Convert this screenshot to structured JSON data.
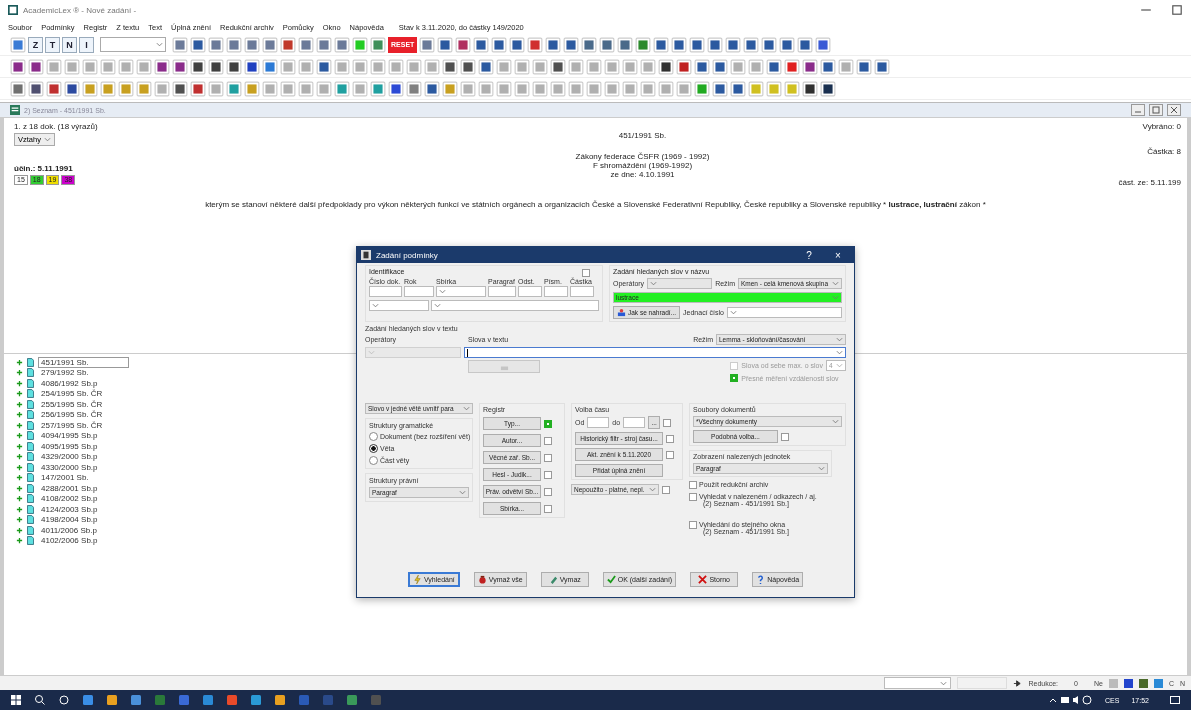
{
  "window": {
    "title": "AcademicLex ® - Nové zadání -"
  },
  "menu": [
    {
      "label": "Soubor"
    },
    {
      "label": "Podmínky"
    },
    {
      "label": "Registr"
    },
    {
      "label": "Z textu"
    },
    {
      "label": "Text"
    },
    {
      "label": "Úplná znění"
    },
    {
      "label": "Redukční archiv"
    },
    {
      "label": "Pomůcky"
    },
    {
      "label": "Okno"
    },
    {
      "label": "Nápověda"
    }
  ],
  "status_info": "Stav k 3.11.2020, do částky 149/2020",
  "toolbars": [
    {
      "items": [
        {
          "kind": "icon",
          "color": "#3a7bd5"
        },
        {
          "kind": "text",
          "label": "Z"
        },
        {
          "kind": "text",
          "label": "T"
        },
        {
          "kind": "text",
          "label": "N"
        },
        {
          "kind": "text",
          "label": "I"
        },
        {
          "kind": "combo"
        },
        {
          "kind": "icon",
          "color": "#6b7a99"
        },
        {
          "kind": "icon",
          "color": "#2c5aa0"
        },
        {
          "kind": "icon",
          "color": "#6b7a99"
        },
        {
          "kind": "icon",
          "color": "#6b7a99"
        },
        {
          "kind": "icon",
          "color": "#6b7a99"
        },
        {
          "kind": "icon",
          "color": "#6b7a99"
        },
        {
          "kind": "icon",
          "color": "#c0392b"
        },
        {
          "kind": "icon",
          "color": "#6b7a99"
        },
        {
          "kind": "icon",
          "color": "#6b7a99"
        },
        {
          "kind": "icon",
          "color": "#6b7a99"
        },
        {
          "kind": "icon",
          "color": "#22cc22"
        },
        {
          "kind": "icon",
          "color": "#3f8f5a"
        },
        {
          "kind": "badge",
          "label": "RESET",
          "color": "#e8202a"
        },
        {
          "kind": "icon",
          "color": "#6b7a99"
        },
        {
          "kind": "icon",
          "color": "#2c5aa0"
        },
        {
          "kind": "icon",
          "color": "#b03060"
        },
        {
          "kind": "icon",
          "color": "#2c5aa0"
        },
        {
          "kind": "icon",
          "color": "#2c5aa0"
        },
        {
          "kind": "icon",
          "color": "#2c5aa0"
        },
        {
          "kind": "icon",
          "color": "#d03030"
        },
        {
          "kind": "icon",
          "color": "#2c5aa0"
        },
        {
          "kind": "icon",
          "color": "#2c5aa0"
        },
        {
          "kind": "icon",
          "color": "#4a6a8a"
        },
        {
          "kind": "icon",
          "color": "#4a6a8a"
        },
        {
          "kind": "icon",
          "color": "#4a6a8a"
        },
        {
          "kind": "icon",
          "color": "#2c8a2c"
        },
        {
          "kind": "icon",
          "color": "#2c5aa0"
        },
        {
          "kind": "icon",
          "color": "#2c5aa0"
        },
        {
          "kind": "icon",
          "color": "#2c5aa0"
        },
        {
          "kind": "icon",
          "color": "#2c5aa0"
        },
        {
          "kind": "icon",
          "color": "#2c5aa0"
        },
        {
          "kind": "icon",
          "color": "#2c5aa0"
        },
        {
          "kind": "icon",
          "color": "#2c5aa0"
        },
        {
          "kind": "icon",
          "color": "#2c5aa0"
        },
        {
          "kind": "icon",
          "color": "#2c5aa0"
        },
        {
          "kind": "icon",
          "color": "#3a5ad5"
        }
      ]
    },
    {
      "items": [
        {
          "kind": "icon",
          "color": "#8a2c8a"
        },
        {
          "kind": "icon",
          "color": "#8a2c8a"
        },
        {
          "kind": "icon",
          "color": "#b0b0b0"
        },
        {
          "kind": "icon",
          "color": "#b0b0b0"
        },
        {
          "kind": "icon",
          "color": "#b0b0b0"
        },
        {
          "kind": "icon",
          "color": "#b0b0b0"
        },
        {
          "kind": "icon",
          "color": "#b0b0b0"
        },
        {
          "kind": "icon",
          "color": "#b0b0b0"
        },
        {
          "kind": "icon",
          "color": "#8a2c8a"
        },
        {
          "kind": "icon",
          "color": "#8a2c8a"
        },
        {
          "kind": "icon",
          "color": "#404040"
        },
        {
          "kind": "icon",
          "color": "#404040"
        },
        {
          "kind": "icon",
          "color": "#404040"
        },
        {
          "kind": "icon",
          "color": "#2040c0"
        },
        {
          "kind": "icon",
          "color": "#2c7ad5"
        },
        {
          "kind": "icon",
          "color": "#b0b0b0"
        },
        {
          "kind": "icon",
          "color": "#b0b0b0"
        },
        {
          "kind": "icon",
          "color": "#2c5aa0"
        },
        {
          "kind": "icon",
          "color": "#b0b0b0"
        },
        {
          "kind": "icon",
          "color": "#b0b0b0"
        },
        {
          "kind": "icon",
          "color": "#b0b0b0"
        },
        {
          "kind": "icon",
          "color": "#b0b0b0"
        },
        {
          "kind": "icon",
          "color": "#b0b0b0"
        },
        {
          "kind": "icon",
          "color": "#b0b0b0"
        },
        {
          "kind": "icon",
          "color": "#505050"
        },
        {
          "kind": "icon",
          "color": "#505050"
        },
        {
          "kind": "icon",
          "color": "#2c5aa0"
        },
        {
          "kind": "icon",
          "color": "#b0b0b0"
        },
        {
          "kind": "icon",
          "color": "#b0b0b0"
        },
        {
          "kind": "icon",
          "color": "#b0b0b0"
        },
        {
          "kind": "icon",
          "color": "#505050"
        },
        {
          "kind": "icon",
          "color": "#b0b0b0"
        },
        {
          "kind": "icon",
          "color": "#b0b0b0"
        },
        {
          "kind": "icon",
          "color": "#b0b0b0"
        },
        {
          "kind": "icon",
          "color": "#b0b0b0"
        },
        {
          "kind": "icon",
          "color": "#b0b0b0"
        },
        {
          "kind": "icon",
          "color": "#303030"
        },
        {
          "kind": "icon",
          "color": "#c02020"
        },
        {
          "kind": "icon",
          "color": "#2c5aa0"
        },
        {
          "kind": "icon",
          "color": "#2c5aa0"
        },
        {
          "kind": "icon",
          "color": "#b0b0b0"
        },
        {
          "kind": "icon",
          "color": "#b0b0b0"
        },
        {
          "kind": "icon",
          "color": "#2c5aa0"
        },
        {
          "kind": "icon",
          "color": "#e02020"
        },
        {
          "kind": "icon",
          "color": "#8a2c8a"
        },
        {
          "kind": "icon",
          "color": "#2c5aa0"
        },
        {
          "kind": "icon",
          "color": "#b0b0b0"
        },
        {
          "kind": "icon",
          "color": "#2c5aa0"
        },
        {
          "kind": "icon",
          "color": "#2c5aa0"
        }
      ]
    },
    {
      "items": [
        {
          "kind": "icon",
          "color": "#707070"
        },
        {
          "kind": "icon",
          "color": "#505070"
        },
        {
          "kind": "icon",
          "color": "#c03030"
        },
        {
          "kind": "icon",
          "color": "#2c4aa0"
        },
        {
          "kind": "icon",
          "color": "#c8a020"
        },
        {
          "kind": "icon",
          "color": "#c8a020"
        },
        {
          "kind": "icon",
          "color": "#c8a020"
        },
        {
          "kind": "icon",
          "color": "#c8a020"
        },
        {
          "kind": "icon",
          "color": "#b0b0b0"
        },
        {
          "kind": "icon",
          "color": "#505050"
        },
        {
          "kind": "icon",
          "color": "#c03030"
        },
        {
          "kind": "icon",
          "color": "#b0b0b0"
        },
        {
          "kind": "icon",
          "color": "#20a0a0"
        },
        {
          "kind": "icon",
          "color": "#c8a020"
        },
        {
          "kind": "icon",
          "color": "#b0b0b0"
        },
        {
          "kind": "icon",
          "color": "#b0b0b0"
        },
        {
          "kind": "icon",
          "color": "#b0b0b0"
        },
        {
          "kind": "icon",
          "color": "#b0b0b0"
        },
        {
          "kind": "icon",
          "color": "#20a0a0"
        },
        {
          "kind": "icon",
          "color": "#b0b0b0"
        },
        {
          "kind": "icon",
          "color": "#20a0a0"
        },
        {
          "kind": "icon",
          "color": "#2c4ad5"
        },
        {
          "kind": "icon",
          "color": "#808080"
        },
        {
          "kind": "icon",
          "color": "#2c5aa0"
        },
        {
          "kind": "icon",
          "color": "#c8a020"
        },
        {
          "kind": "icon",
          "color": "#b0b0b0"
        },
        {
          "kind": "icon",
          "color": "#b0b0b0"
        },
        {
          "kind": "icon",
          "color": "#b0b0b0"
        },
        {
          "kind": "icon",
          "color": "#b0b0b0"
        },
        {
          "kind": "icon",
          "color": "#b0b0b0"
        },
        {
          "kind": "icon",
          "color": "#b0b0b0"
        },
        {
          "kind": "icon",
          "color": "#b0b0b0"
        },
        {
          "kind": "icon",
          "color": "#b0b0b0"
        },
        {
          "kind": "icon",
          "color": "#b0b0b0"
        },
        {
          "kind": "icon",
          "color": "#b0b0b0"
        },
        {
          "kind": "icon",
          "color": "#b0b0b0"
        },
        {
          "kind": "icon",
          "color": "#b0b0b0"
        },
        {
          "kind": "icon",
          "color": "#b0b0b0"
        },
        {
          "kind": "icon",
          "color": "#22aa22"
        },
        {
          "kind": "icon",
          "color": "#2c5aa0"
        },
        {
          "kind": "icon",
          "color": "#2c5aa0"
        },
        {
          "kind": "icon",
          "color": "#d0c020"
        },
        {
          "kind": "icon",
          "color": "#d0c020"
        },
        {
          "kind": "icon",
          "color": "#d0c020"
        },
        {
          "kind": "icon",
          "color": "#303030"
        },
        {
          "kind": "icon",
          "color": "#1a3050"
        }
      ]
    }
  ],
  "doc_window": {
    "title": "2) Seznam - 451/1991 Sb.",
    "count": "1. z 18 dok. (18 výrazů)",
    "relations_button": "Vztahy",
    "effective": "účin.: 5.11.1991",
    "chips": [
      {
        "label": "15",
        "color": "#ffffff"
      },
      {
        "label": "18",
        "color": "#33cc33"
      },
      {
        "label": "19",
        "color": "#eedd00"
      },
      {
        "label": "38",
        "color": "#cc00cc"
      }
    ],
    "center_lines": [
      "451/1991 Sb.",
      "Zákony federace ČSFR (1969 - 1992)",
      "F shromáždění (1969-1992)",
      "ze dne: 4.10.1991"
    ],
    "selected_count": "Vybráno: 0",
    "part": "Částka: 8",
    "part_from": "část. ze: 5.11.199",
    "heading": "kterým se stanoví některé další předpoklady pro výkon některých funkcí ve státních orgánech a organizacích České a Slovenské Federativní Republiky, České republiky a Slovenské republiky * **lustrace, lustrační** zákon *"
  },
  "documents": [
    {
      "label": "451/1991 Sb.",
      "selected": true
    },
    {
      "label": "279/1992 Sb.",
      "selected": false
    },
    {
      "label": "4086/1992 Sb.p",
      "selected": false
    },
    {
      "label": "254/1995 Sb. ČR",
      "selected": false
    },
    {
      "label": "255/1995 Sb. ČR",
      "selected": false
    },
    {
      "label": "256/1995 Sb. ČR",
      "selected": false
    },
    {
      "label": "257/1995 Sb. ČR",
      "selected": false
    },
    {
      "label": "4094/1995 Sb.p",
      "selected": false
    },
    {
      "label": "4095/1995 Sb.p",
      "selected": false
    },
    {
      "label": "4329/2000 Sb.p",
      "selected": false
    },
    {
      "label": "4330/2000 Sb.p",
      "selected": false
    },
    {
      "label": "147/2001 Sb.",
      "selected": false
    },
    {
      "label": "4288/2001 Sb.p",
      "selected": false
    },
    {
      "label": "4108/2002 Sb.p",
      "selected": false
    },
    {
      "label": "4124/2003 Sb.p",
      "selected": false
    },
    {
      "label": "4198/2004 Sb.p",
      "selected": false
    },
    {
      "label": "4011/2006 Sb.p",
      "selected": false
    },
    {
      "label": "4102/2006 Sb.p",
      "selected": false
    }
  ],
  "dialog": {
    "title": "Zadání podmínky",
    "help": "?",
    "close": "×",
    "identification": {
      "title": "Identifikace",
      "checked": false,
      "labels": [
        "Číslo dok.",
        "Rok",
        "Sbírka",
        "Paragraf",
        "Odst.",
        "Písm.",
        "Částka"
      ]
    },
    "title_search": {
      "title": "Zadání hledaných slov v názvu",
      "operators_label": "Operátory",
      "mode_label": "Režim",
      "mode_value": "Kmen - celá kmenová skupina",
      "words_value": "lustrace",
      "replace_button": "Jak se nahradí...",
      "reference_label": "Jednací číslo"
    },
    "text_search": {
      "title": "Zadání hledaných slov v textu",
      "operators_label": "Operátory",
      "words_label": "Slova v textu",
      "mode_label": "Režim",
      "mode_value": "Lemma - skloňování/časování",
      "distance_label": "Slova od sebe max. o slov",
      "distance_checked": false,
      "distance_value": "4",
      "exact_label": "Přesné měření vzdálenosti slov",
      "exact_checked": true
    },
    "scope_value": "Slovo v jedné větě uvnitř para",
    "grammar": {
      "title": "Struktury gramatické",
      "options": [
        {
          "label": "Dokument (bez rozšíření vět)",
          "selected": false
        },
        {
          "label": "Věta",
          "selected": true
        },
        {
          "label": "Část věty",
          "selected": false
        }
      ]
    },
    "legal": {
      "title": "Struktury právní",
      "value": "Paragraf"
    },
    "registry": {
      "title": "Registr",
      "buttons": [
        {
          "label": "Typ...",
          "checked": true
        },
        {
          "label": "Autor...",
          "checked": false
        },
        {
          "label": "Věcné zař. Sb...",
          "checked": false
        },
        {
          "label": "Hesl - Judik...",
          "checked": false
        },
        {
          "label": "Práv. odvětví Sb...",
          "checked": false
        },
        {
          "label": "Sbírka...",
          "checked": false
        }
      ]
    },
    "time": {
      "title": "Volba času",
      "from_label": "Od",
      "to_label": "do",
      "more": "...",
      "range_checked": false,
      "history_button": "Historický filtr - stroj času...",
      "history_checked": false,
      "current_button": "Akt. znění k 5.11.2020",
      "current_checked": false,
      "full_button": "Přidat úplná znění",
      "validity_value": "Nepoužito - platné, nepl.",
      "validity_checked": false
    },
    "files": {
      "title": "Soubory dokumentů",
      "value": "*Všechny dokumenty",
      "similar_button": "Podobná volba...",
      "similar_checked": false
    },
    "display": {
      "title": "Zobrazení nalezených jednotek",
      "value": "Paragraf"
    },
    "options": [
      {
        "label": "Použít redukční archiv",
        "checked": false
      },
      {
        "label": "Vyhledat v nalezeném / odkazech / aj.",
        "note": "(2) Seznam - 451/1991 Sb.]",
        "checked": false
      },
      {
        "label": "Vyhledání do stejného okna",
        "note": "(2) Seznam - 451/1991 Sb.]",
        "checked": false
      }
    ],
    "buttons": [
      {
        "label": "Vyhledání",
        "kind": "search"
      },
      {
        "label": "Vymaž vše",
        "kind": "clear-all"
      },
      {
        "label": "Vymaz",
        "kind": "clear"
      },
      {
        "label": "OK (další zadání)",
        "kind": "ok"
      },
      {
        "label": "Storno",
        "kind": "cancel"
      },
      {
        "label": "Nápověda",
        "kind": "help"
      }
    ]
  },
  "status_bar": {
    "reduction_label": "Redukce:",
    "reduction_value": "0",
    "mode": "Ne",
    "cut_1": "C",
    "cut_2": "N"
  },
  "taskbar": {
    "apps": [
      {
        "color": "#3a8ee6"
      },
      {
        "color": "#e8a020"
      },
      {
        "color": "#4a90d9"
      },
      {
        "color": "#2a7a3a"
      },
      {
        "color": "#3a6ad6"
      },
      {
        "color": "#2a8ad6"
      },
      {
        "color": "#e84a2a"
      },
      {
        "color": "#2a9ad6"
      },
      {
        "color": "#e8a020"
      },
      {
        "color": "#2a5ab6"
      },
      {
        "color": "#2a4a8a"
      },
      {
        "color": "#3a9a5a"
      },
      {
        "color": "#505050"
      }
    ],
    "language": "CES",
    "time": "17:52"
  }
}
